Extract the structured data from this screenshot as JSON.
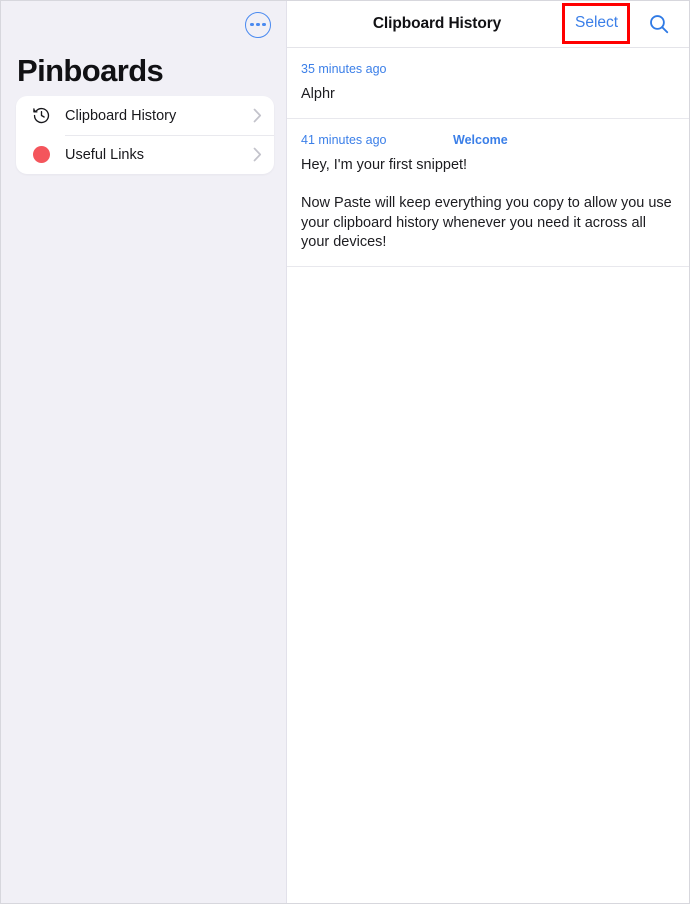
{
  "sidebar": {
    "more_button": {
      "icon": "ellipsis-icon",
      "label": "More options"
    },
    "title": "Pinboards",
    "items": [
      {
        "label": "Clipboard History",
        "icon": "history-clock-icon",
        "chevron": "chevron-right-icon"
      },
      {
        "label": "Useful Links",
        "icon": "red-dot-icon",
        "chevron": "chevron-right-icon",
        "dot_color": "#f4555c"
      }
    ]
  },
  "main": {
    "header": {
      "title": "Clipboard History",
      "select_label": "Select",
      "search_icon": "search-icon"
    },
    "snippets": [
      {
        "time": "35 minutes ago",
        "tag": "",
        "paragraphs": [
          "Alphr"
        ]
      },
      {
        "time": "41 minutes ago",
        "tag": "Welcome",
        "paragraphs": [
          "Hey, I'm your first snippet!",
          "Now Paste will keep everything you copy to allow you use your clipboard history whenever you need it across all your devices!"
        ]
      }
    ]
  },
  "annotation": {
    "highlight_target": "Select",
    "color": "#ff0000"
  },
  "colors": {
    "accent_blue": "#3b7fe8",
    "sidebar_bg": "#f1f0f6",
    "red_dot": "#f4555c",
    "highlight_red": "#ff0000"
  }
}
